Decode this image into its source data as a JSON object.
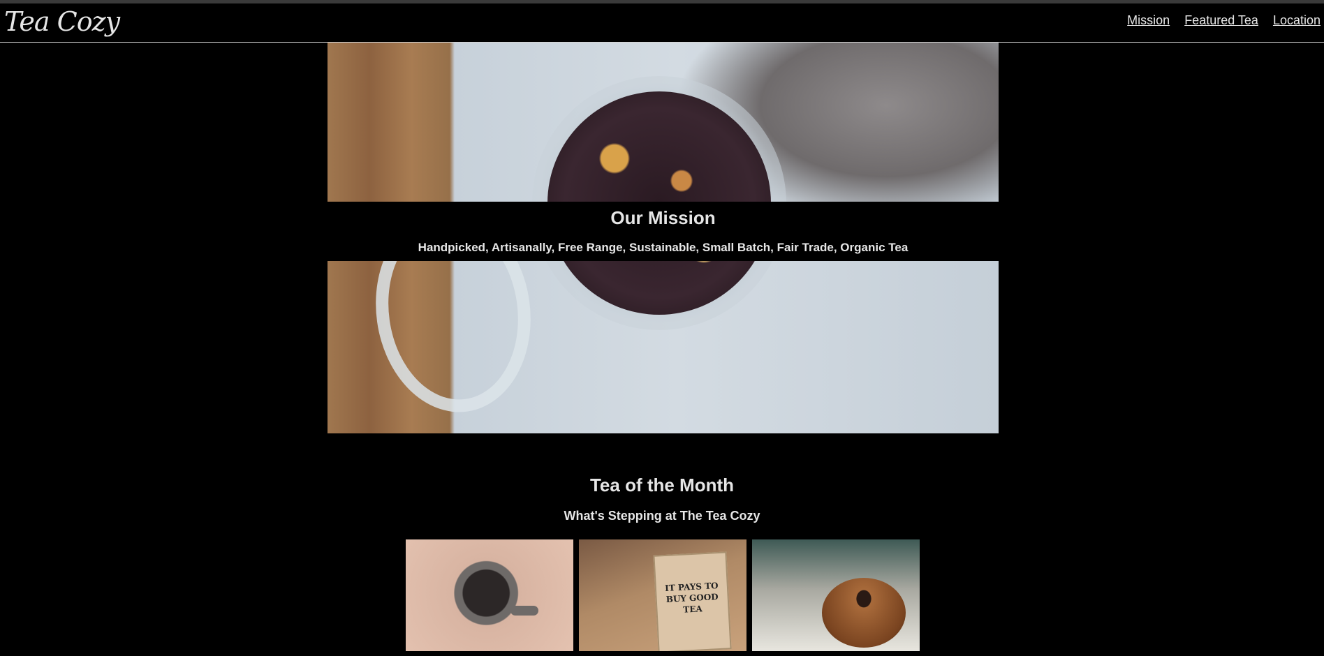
{
  "header": {
    "logo": "Tea Cozy",
    "nav": [
      "Mission",
      "Featured Tea",
      "Location"
    ]
  },
  "mission": {
    "title": "Our Mission",
    "subtitle": "Handpicked, Artisanally, Free Range, Sustainable, Small Batch, Fair Trade, Organic Tea"
  },
  "tea_of_month": {
    "title": "Tea of the Month",
    "subtitle": "What's Stepping at The Tea Cozy",
    "tiles": [
      {
        "image": "tea-cup-with-berries"
      },
      {
        "image": "tea-box",
        "box_text": "IT PAYS TO BUY GOOD TEA"
      },
      {
        "image": "donut-on-plate"
      }
    ]
  }
}
